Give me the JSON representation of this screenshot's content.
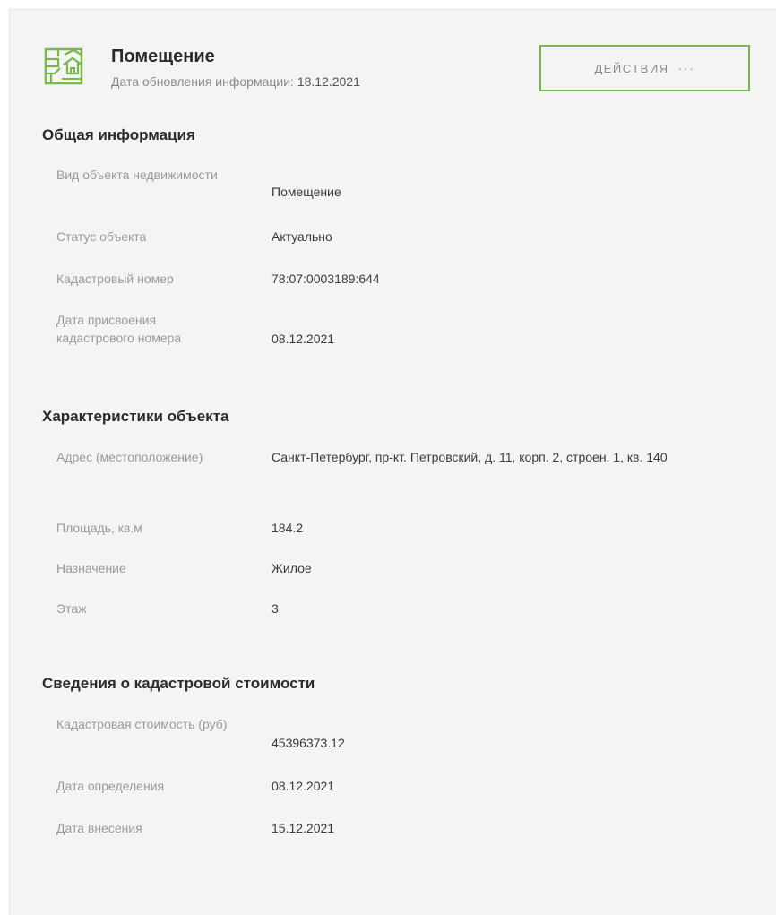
{
  "header": {
    "title": "Помещение",
    "update_label": "Дата обновления информации:",
    "update_date": "18.12.2021",
    "actions_label": "действия",
    "actions_dots": "···",
    "icon": "building-plan-icon",
    "accent_color": "#7ab648"
  },
  "general": {
    "title": "Общая информация",
    "rows": [
      {
        "label": "Вид объекта недвижимости",
        "value": "Помещение"
      },
      {
        "label": "Статус объекта",
        "value": "Актуально"
      },
      {
        "label": "Кадастровый номер",
        "value": "78:07:0003189:644"
      },
      {
        "label": "Дата присвоения кадастрового номера",
        "value": "08.12.2021"
      }
    ]
  },
  "characteristics": {
    "title": "Характеристики объекта",
    "rows": [
      {
        "label": "Адрес (местоположение)",
        "value": "Санкт-Петербург, пр-кт. Петровский, д. 11, корп. 2, строен. 1, кв. 140"
      },
      {
        "label": "Площадь, кв.м",
        "value": "184.2"
      },
      {
        "label": "Назначение",
        "value": "Жилое"
      },
      {
        "label": "Этаж",
        "value": "3"
      }
    ]
  },
  "cadastral_value": {
    "title": "Сведения о кадастровой стоимости",
    "rows": [
      {
        "label": "Кадастровая стоимость (руб)",
        "value": "45396373.12"
      },
      {
        "label": "Дата определения",
        "value": "08.12.2021"
      },
      {
        "label": "Дата внесения",
        "value": "15.12.2021"
      }
    ]
  }
}
